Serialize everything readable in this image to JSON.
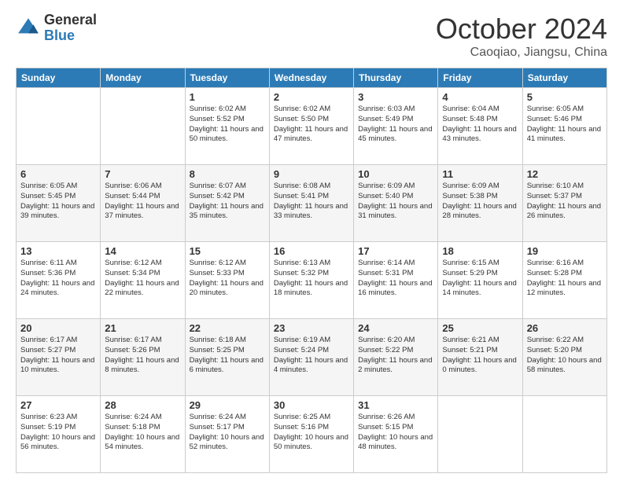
{
  "logo": {
    "general": "General",
    "blue": "Blue"
  },
  "title": "October 2024",
  "subtitle": "Caoqiao, Jiangsu, China",
  "weekdays": [
    "Sunday",
    "Monday",
    "Tuesday",
    "Wednesday",
    "Thursday",
    "Friday",
    "Saturday"
  ],
  "weeks": [
    [
      {
        "day": "",
        "info": ""
      },
      {
        "day": "",
        "info": ""
      },
      {
        "day": "1",
        "info": "Sunrise: 6:02 AM\nSunset: 5:52 PM\nDaylight: 11 hours and 50 minutes."
      },
      {
        "day": "2",
        "info": "Sunrise: 6:02 AM\nSunset: 5:50 PM\nDaylight: 11 hours and 47 minutes."
      },
      {
        "day": "3",
        "info": "Sunrise: 6:03 AM\nSunset: 5:49 PM\nDaylight: 11 hours and 45 minutes."
      },
      {
        "day": "4",
        "info": "Sunrise: 6:04 AM\nSunset: 5:48 PM\nDaylight: 11 hours and 43 minutes."
      },
      {
        "day": "5",
        "info": "Sunrise: 6:05 AM\nSunset: 5:46 PM\nDaylight: 11 hours and 41 minutes."
      }
    ],
    [
      {
        "day": "6",
        "info": "Sunrise: 6:05 AM\nSunset: 5:45 PM\nDaylight: 11 hours and 39 minutes."
      },
      {
        "day": "7",
        "info": "Sunrise: 6:06 AM\nSunset: 5:44 PM\nDaylight: 11 hours and 37 minutes."
      },
      {
        "day": "8",
        "info": "Sunrise: 6:07 AM\nSunset: 5:42 PM\nDaylight: 11 hours and 35 minutes."
      },
      {
        "day": "9",
        "info": "Sunrise: 6:08 AM\nSunset: 5:41 PM\nDaylight: 11 hours and 33 minutes."
      },
      {
        "day": "10",
        "info": "Sunrise: 6:09 AM\nSunset: 5:40 PM\nDaylight: 11 hours and 31 minutes."
      },
      {
        "day": "11",
        "info": "Sunrise: 6:09 AM\nSunset: 5:38 PM\nDaylight: 11 hours and 28 minutes."
      },
      {
        "day": "12",
        "info": "Sunrise: 6:10 AM\nSunset: 5:37 PM\nDaylight: 11 hours and 26 minutes."
      }
    ],
    [
      {
        "day": "13",
        "info": "Sunrise: 6:11 AM\nSunset: 5:36 PM\nDaylight: 11 hours and 24 minutes."
      },
      {
        "day": "14",
        "info": "Sunrise: 6:12 AM\nSunset: 5:34 PM\nDaylight: 11 hours and 22 minutes."
      },
      {
        "day": "15",
        "info": "Sunrise: 6:12 AM\nSunset: 5:33 PM\nDaylight: 11 hours and 20 minutes."
      },
      {
        "day": "16",
        "info": "Sunrise: 6:13 AM\nSunset: 5:32 PM\nDaylight: 11 hours and 18 minutes."
      },
      {
        "day": "17",
        "info": "Sunrise: 6:14 AM\nSunset: 5:31 PM\nDaylight: 11 hours and 16 minutes."
      },
      {
        "day": "18",
        "info": "Sunrise: 6:15 AM\nSunset: 5:29 PM\nDaylight: 11 hours and 14 minutes."
      },
      {
        "day": "19",
        "info": "Sunrise: 6:16 AM\nSunset: 5:28 PM\nDaylight: 11 hours and 12 minutes."
      }
    ],
    [
      {
        "day": "20",
        "info": "Sunrise: 6:17 AM\nSunset: 5:27 PM\nDaylight: 11 hours and 10 minutes."
      },
      {
        "day": "21",
        "info": "Sunrise: 6:17 AM\nSunset: 5:26 PM\nDaylight: 11 hours and 8 minutes."
      },
      {
        "day": "22",
        "info": "Sunrise: 6:18 AM\nSunset: 5:25 PM\nDaylight: 11 hours and 6 minutes."
      },
      {
        "day": "23",
        "info": "Sunrise: 6:19 AM\nSunset: 5:24 PM\nDaylight: 11 hours and 4 minutes."
      },
      {
        "day": "24",
        "info": "Sunrise: 6:20 AM\nSunset: 5:22 PM\nDaylight: 11 hours and 2 minutes."
      },
      {
        "day": "25",
        "info": "Sunrise: 6:21 AM\nSunset: 5:21 PM\nDaylight: 11 hours and 0 minutes."
      },
      {
        "day": "26",
        "info": "Sunrise: 6:22 AM\nSunset: 5:20 PM\nDaylight: 10 hours and 58 minutes."
      }
    ],
    [
      {
        "day": "27",
        "info": "Sunrise: 6:23 AM\nSunset: 5:19 PM\nDaylight: 10 hours and 56 minutes."
      },
      {
        "day": "28",
        "info": "Sunrise: 6:24 AM\nSunset: 5:18 PM\nDaylight: 10 hours and 54 minutes."
      },
      {
        "day": "29",
        "info": "Sunrise: 6:24 AM\nSunset: 5:17 PM\nDaylight: 10 hours and 52 minutes."
      },
      {
        "day": "30",
        "info": "Sunrise: 6:25 AM\nSunset: 5:16 PM\nDaylight: 10 hours and 50 minutes."
      },
      {
        "day": "31",
        "info": "Sunrise: 6:26 AM\nSunset: 5:15 PM\nDaylight: 10 hours and 48 minutes."
      },
      {
        "day": "",
        "info": ""
      },
      {
        "day": "",
        "info": ""
      }
    ]
  ]
}
